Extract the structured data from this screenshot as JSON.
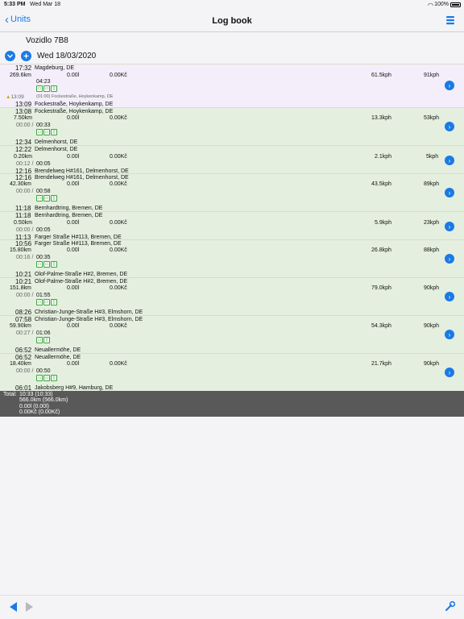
{
  "status": {
    "time": "5:33 PM",
    "date": "Wed Mar 18",
    "battery": "100%"
  },
  "nav": {
    "back_label": "Units",
    "title": "Log book"
  },
  "vehicle": "Vozidlo 7B8",
  "day": "Wed 18/03/2020",
  "records": [
    {
      "end_time": "17:32",
      "end_place": "Magdeburg, DE",
      "distance": "269.6km",
      "fuel": "0.00l",
      "cost": "0.00Kč",
      "avg_speed": "61.5kph",
      "max_speed": "91kph",
      "duration": "04:23",
      "warn_time": "13:09",
      "warn_text": "(01:00) Fockestraße, Hoykenkamp, DE",
      "start_time": "13:09",
      "start_place": "Fockestraße, Hoykenkamp, DE"
    },
    {
      "end_time": "13:08",
      "end_place": "Fockestraße, Hoykenkamp, DE",
      "distance": "7.50km",
      "fuel": "0.00l",
      "cost": "0.00Kč",
      "avg_speed": "13.3kph",
      "max_speed": "53kph",
      "idle": "00:00",
      "duration": "00:33",
      "start_time": "12:34",
      "start_place": "Delmenhorst, DE"
    },
    {
      "end_time": "12:22",
      "end_place": "Delmenhorst, DE",
      "distance": "0.20km",
      "fuel": "0.00l",
      "cost": "0.00Kč",
      "avg_speed": "2.1kph",
      "max_speed": "5kph",
      "idle": "00:12",
      "duration": "00:05",
      "start_time": "12:16",
      "start_place": "Brendelweg H#161, Delmenhorst, DE"
    },
    {
      "end_time": "12:16",
      "end_place": "Brendelweg H#161, Delmenhorst, DE",
      "distance": "42.30km",
      "fuel": "0.00l",
      "cost": "0.00Kč",
      "avg_speed": "43.5kph",
      "max_speed": "89kph",
      "idle": "00:00",
      "duration": "00:58",
      "start_time": "11:18",
      "start_place": "Bernhardtring, Bremen, DE"
    },
    {
      "end_time": "11:18",
      "end_place": "Bernhardtring, Bremen, DE",
      "distance": "0.50km",
      "fuel": "0.00l",
      "cost": "0.00Kč",
      "avg_speed": "5.9kph",
      "max_speed": "23kph",
      "idle": "00:00",
      "duration": "00:05",
      "start_time": "11:13",
      "start_place": "Farger Straße H#113, Bremen, DE"
    },
    {
      "end_time": "10:56",
      "end_place": "Farger Straße H#113, Bremen, DE",
      "distance": "15.80km",
      "fuel": "0.00l",
      "cost": "0.00Kč",
      "avg_speed": "26.8kph",
      "max_speed": "88kph",
      "idle": "00:16",
      "duration": "00:35",
      "start_time": "10:21",
      "start_place": "Olof-Palme-Straße H#2, Bremen, DE"
    },
    {
      "end_time": "10:21",
      "end_place": "Olof-Palme-Straße H#2, Bremen, DE",
      "distance": "151.8km",
      "fuel": "0.00l",
      "cost": "0.00Kč",
      "avg_speed": "79.0kph",
      "max_speed": "90kph",
      "idle": "00:00",
      "duration": "01:55",
      "start_time": "08:26",
      "start_place": "Christian-Junge-Straße H#3, Elmshorn, DE"
    },
    {
      "end_time": "07:58",
      "end_place": "Christian-Junge-Straße H#3, Elmshorn, DE",
      "distance": "59.90km",
      "fuel": "0.00l",
      "cost": "0.00Kč",
      "avg_speed": "54.3kph",
      "max_speed": "90kph",
      "idle": "00:27",
      "duration": "01:06",
      "start_time": "06:52",
      "start_place": "Neuallermöhe, DE"
    },
    {
      "end_time": "06:52",
      "end_place": "Neuallermöhe, DE",
      "distance": "18.40km",
      "fuel": "0.00l",
      "cost": "0.00Kč",
      "avg_speed": "21.7kph",
      "max_speed": "90kph",
      "idle": "00:00",
      "duration": "00:50",
      "start_time": "06:01",
      "start_place": "Jakobsberg H#9, Hamburg, DE"
    }
  ],
  "totals": {
    "label": "Total:",
    "time": "10:33 (10:33)",
    "distance": "566.0km (566.0km)",
    "fuel": "0.00l (0.00l)",
    "cost": "0.00Kč (0.00Kč)"
  },
  "colors": {
    "accent": "#1a7ae6",
    "first_row_bg": "#f3eef9",
    "row_bg": "#e4efdf",
    "totals_bg": "#595959"
  },
  "icons": {
    "trip_icons": [
      "car-icon",
      "truck-icon",
      "fuel-icon"
    ],
    "warning": "warning-icon"
  }
}
